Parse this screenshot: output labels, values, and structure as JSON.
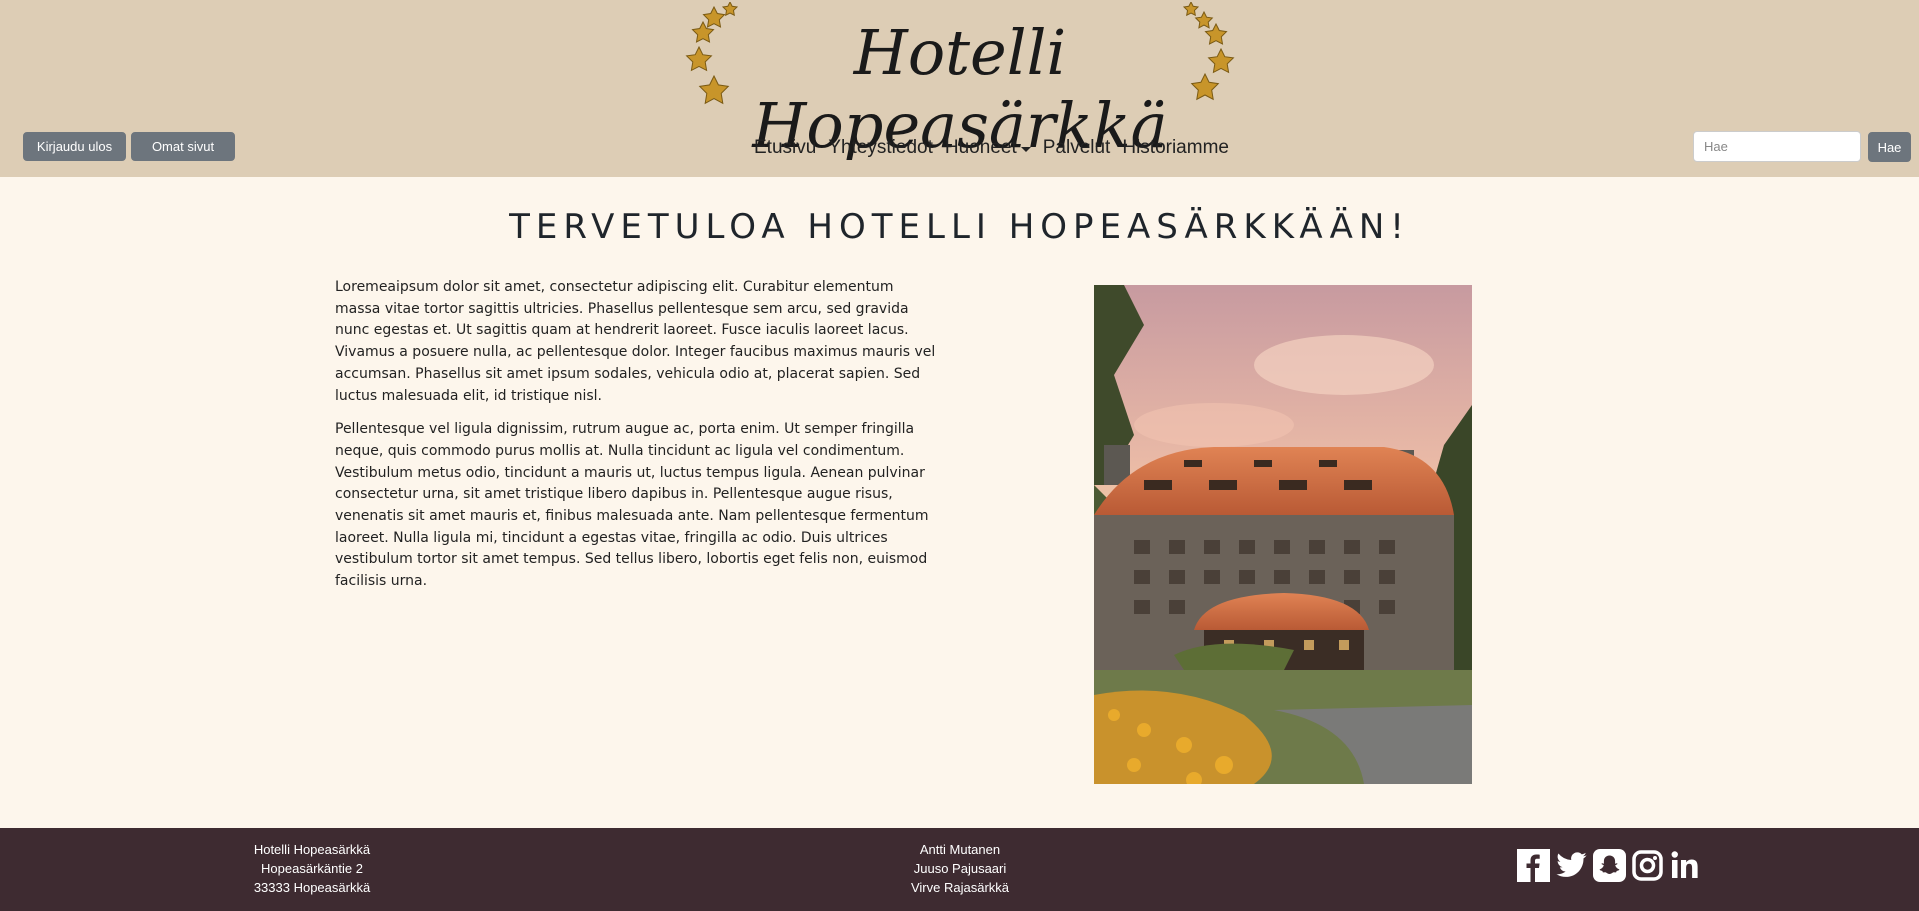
{
  "header": {
    "logo_text": "Hotelli Hopeasärkkä",
    "logout_label": "Kirjaudu ulos",
    "mypages_label": "Omat sivut",
    "search": {
      "placeholder": "Hae",
      "button_label": "Hae"
    },
    "nav": [
      {
        "label": "Etusivu"
      },
      {
        "label": "Yhteystiedot"
      },
      {
        "label": "Huoneet",
        "dropdown": true
      },
      {
        "label": "Palvelut"
      },
      {
        "label": "Historiamme"
      }
    ]
  },
  "main": {
    "title": "TERVETULOA HOTELLI HOPEASÄRKKÄÄN!",
    "paragraphs": [
      "Loremeaipsum dolor sit amet, consectetur adipiscing elit. Curabitur elementum massa vitae tortor sagittis ultricies. Phasellus pellentesque sem arcu, sed gravida nunc egestas et. Ut sagittis quam at hendrerit laoreet. Fusce iaculis laoreet lacus. Vivamus a posuere nulla, ac pellentesque dolor. Integer faucibus maximus mauris vel accumsan. Phasellus sit amet ipsum sodales, vehicula odio at, placerat sapien. Sed luctus malesuada elit, id tristique nisl.",
      "Pellentesque vel ligula dignissim, rutrum augue ac, porta enim. Ut semper fringilla neque, quis commodo purus mollis at. Nulla tincidunt ac ligula vel condimentum. Vestibulum metus odio, tincidunt a mauris ut, luctus tempus ligula. Aenean pulvinar consectetur urna, sit amet tristique libero dapibus in. Pellentesque augue risus, venenatis sit amet mauris et, finibus malesuada ante. Nam pellentesque fermentum laoreet. Nulla ligula mi, tincidunt a egestas vitae, fringilla ac odio. Duis ultrices vestibulum tortor sit amet tempus. Sed tellus libero, lobortis eget felis non, euismod facilisis urna."
    ]
  },
  "footer": {
    "address": [
      "Hotelli Hopeasärkkä",
      "Hopeasärkäntie 2",
      "33333 Hopeasärkkä"
    ],
    "people": [
      "Antti Mutanen",
      "Juuso Pajusaari",
      "Virve Rajasärkkä"
    ],
    "social": [
      "facebook-icon",
      "twitter-icon",
      "snapchat-icon",
      "instagram-icon",
      "linkedin-icon"
    ]
  },
  "colors": {
    "header_bg": "#ddcdb5",
    "page_bg": "#fdf6ec",
    "footer_bg": "#3e2b31",
    "button_bg": "#6d757d",
    "star_gold": "#c8952a"
  }
}
